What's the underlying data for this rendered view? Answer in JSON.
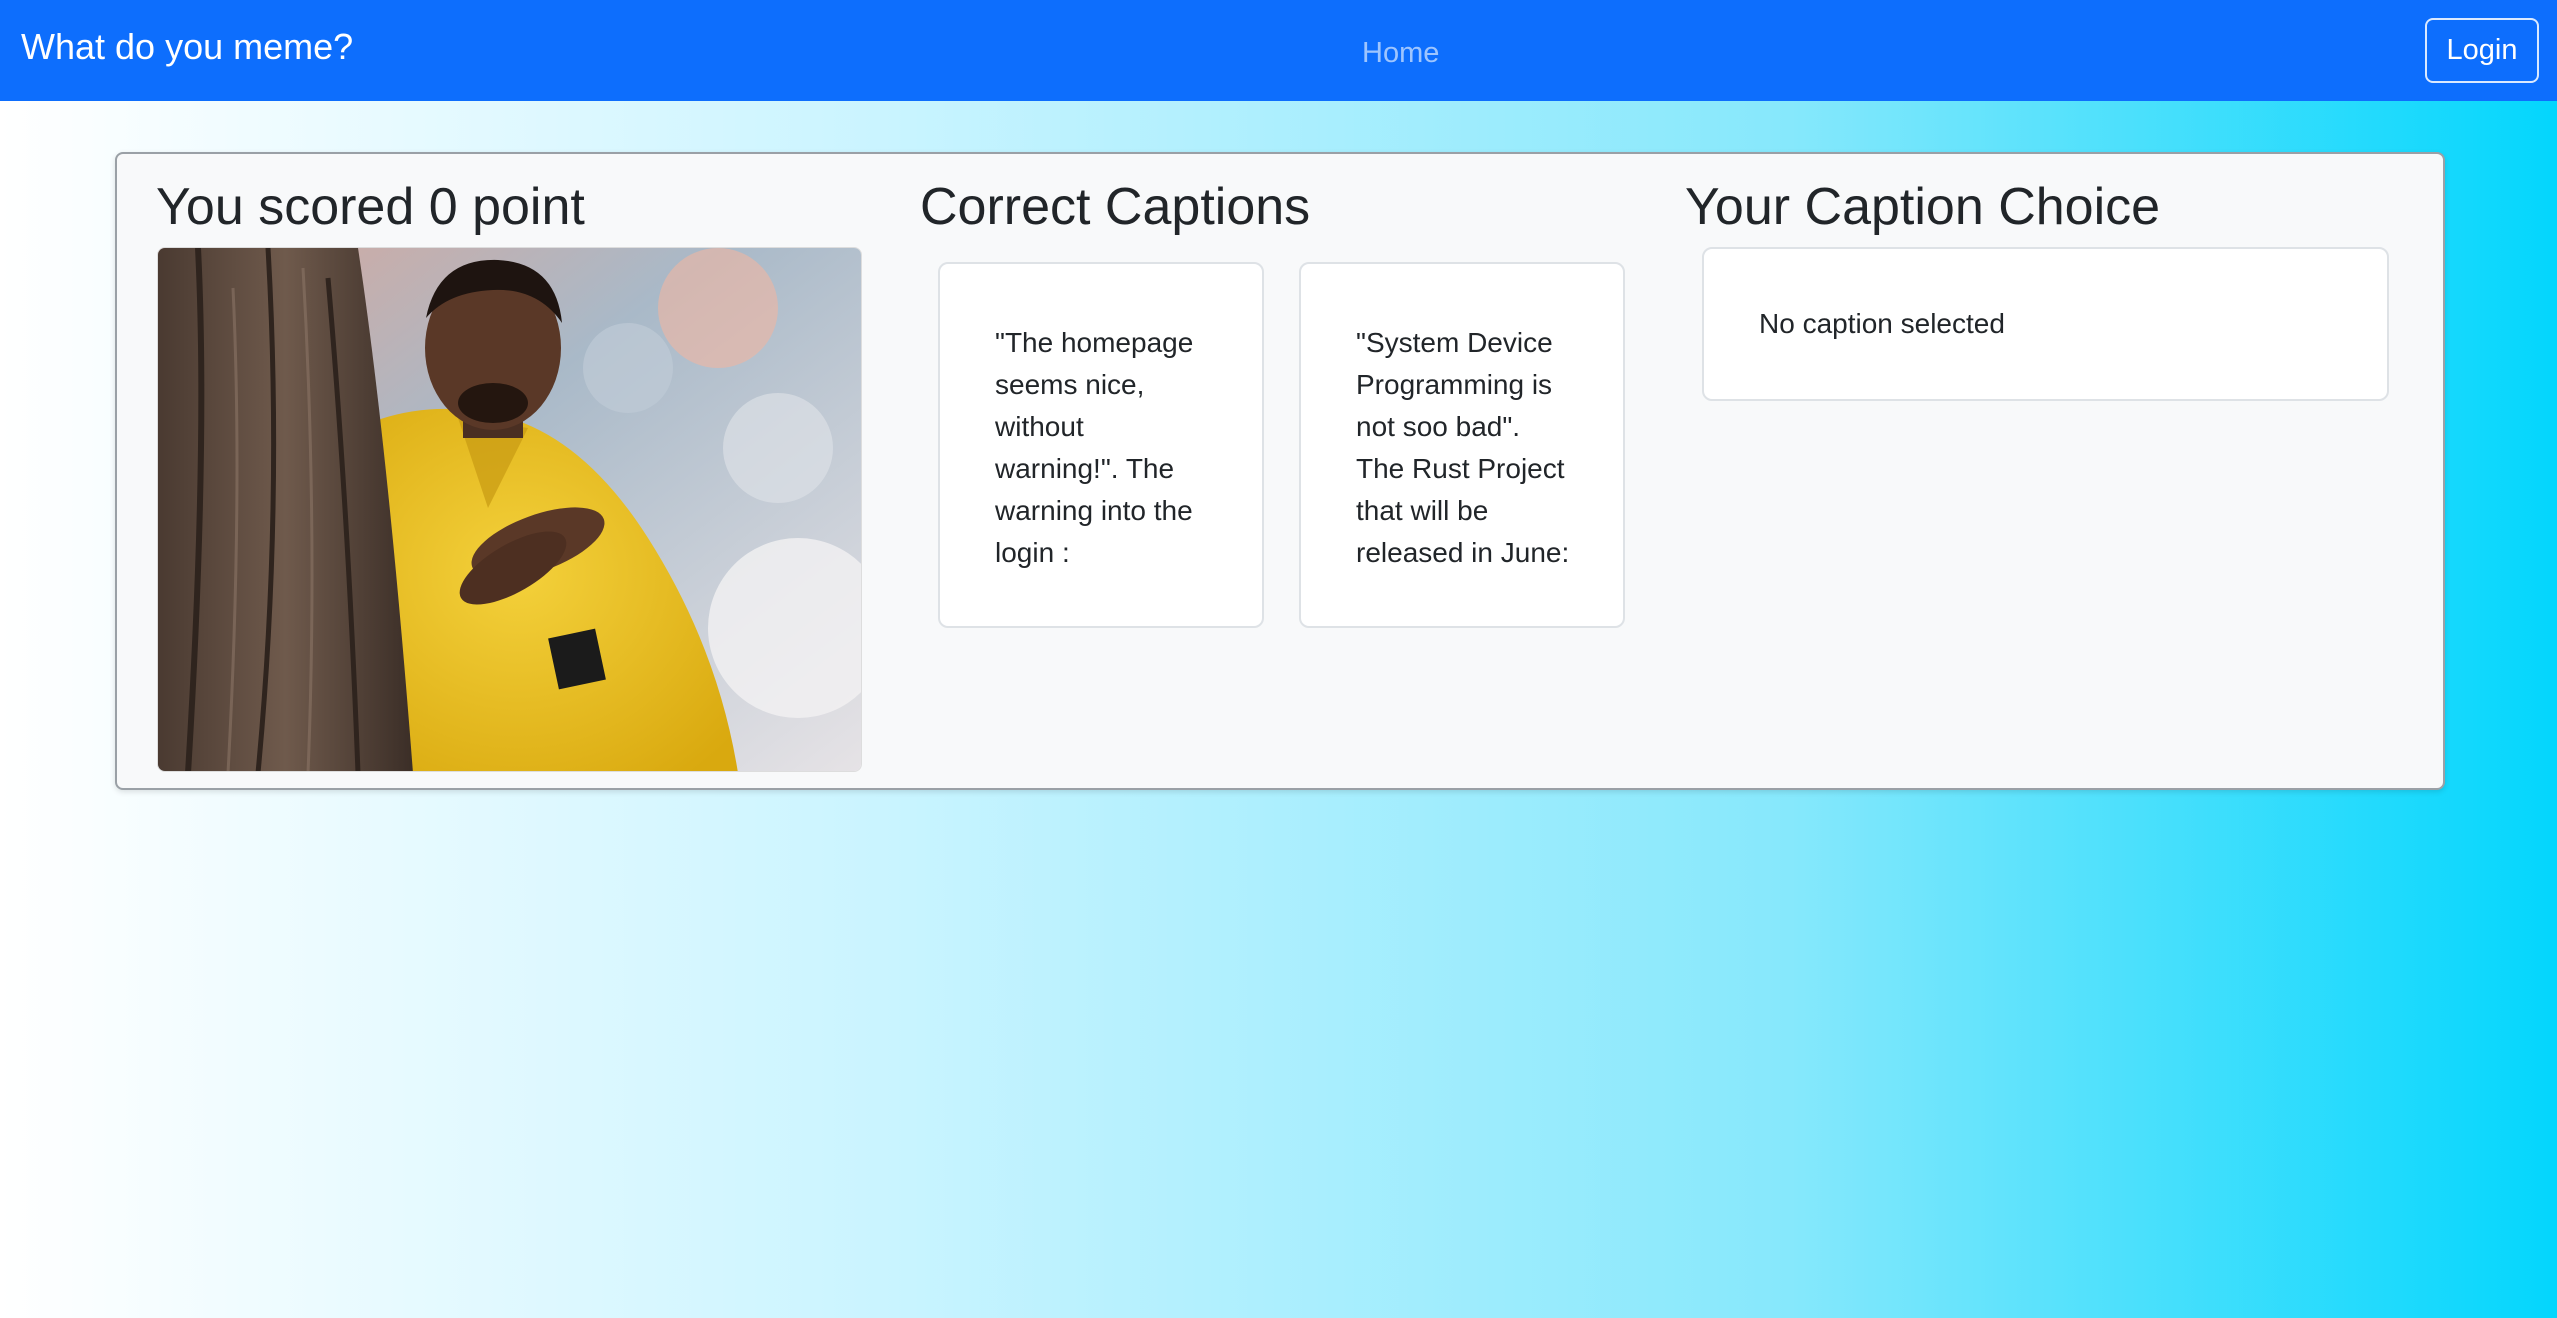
{
  "navbar": {
    "brand": "What do you meme?",
    "home_link": "Home",
    "login_label": "Login",
    "background_color": "#0d6efd"
  },
  "result": {
    "score_heading": "You scored 0 point",
    "correct_heading": "Correct Captions",
    "choice_heading": "Your Caption Choice",
    "correct_captions": [
      "\"The homepage seems nice, without warning!\". The warning into the login :",
      "\"System Device Programming is not soo bad\". The Rust Project that will be released in June:"
    ],
    "choice_text": "No caption selected"
  }
}
